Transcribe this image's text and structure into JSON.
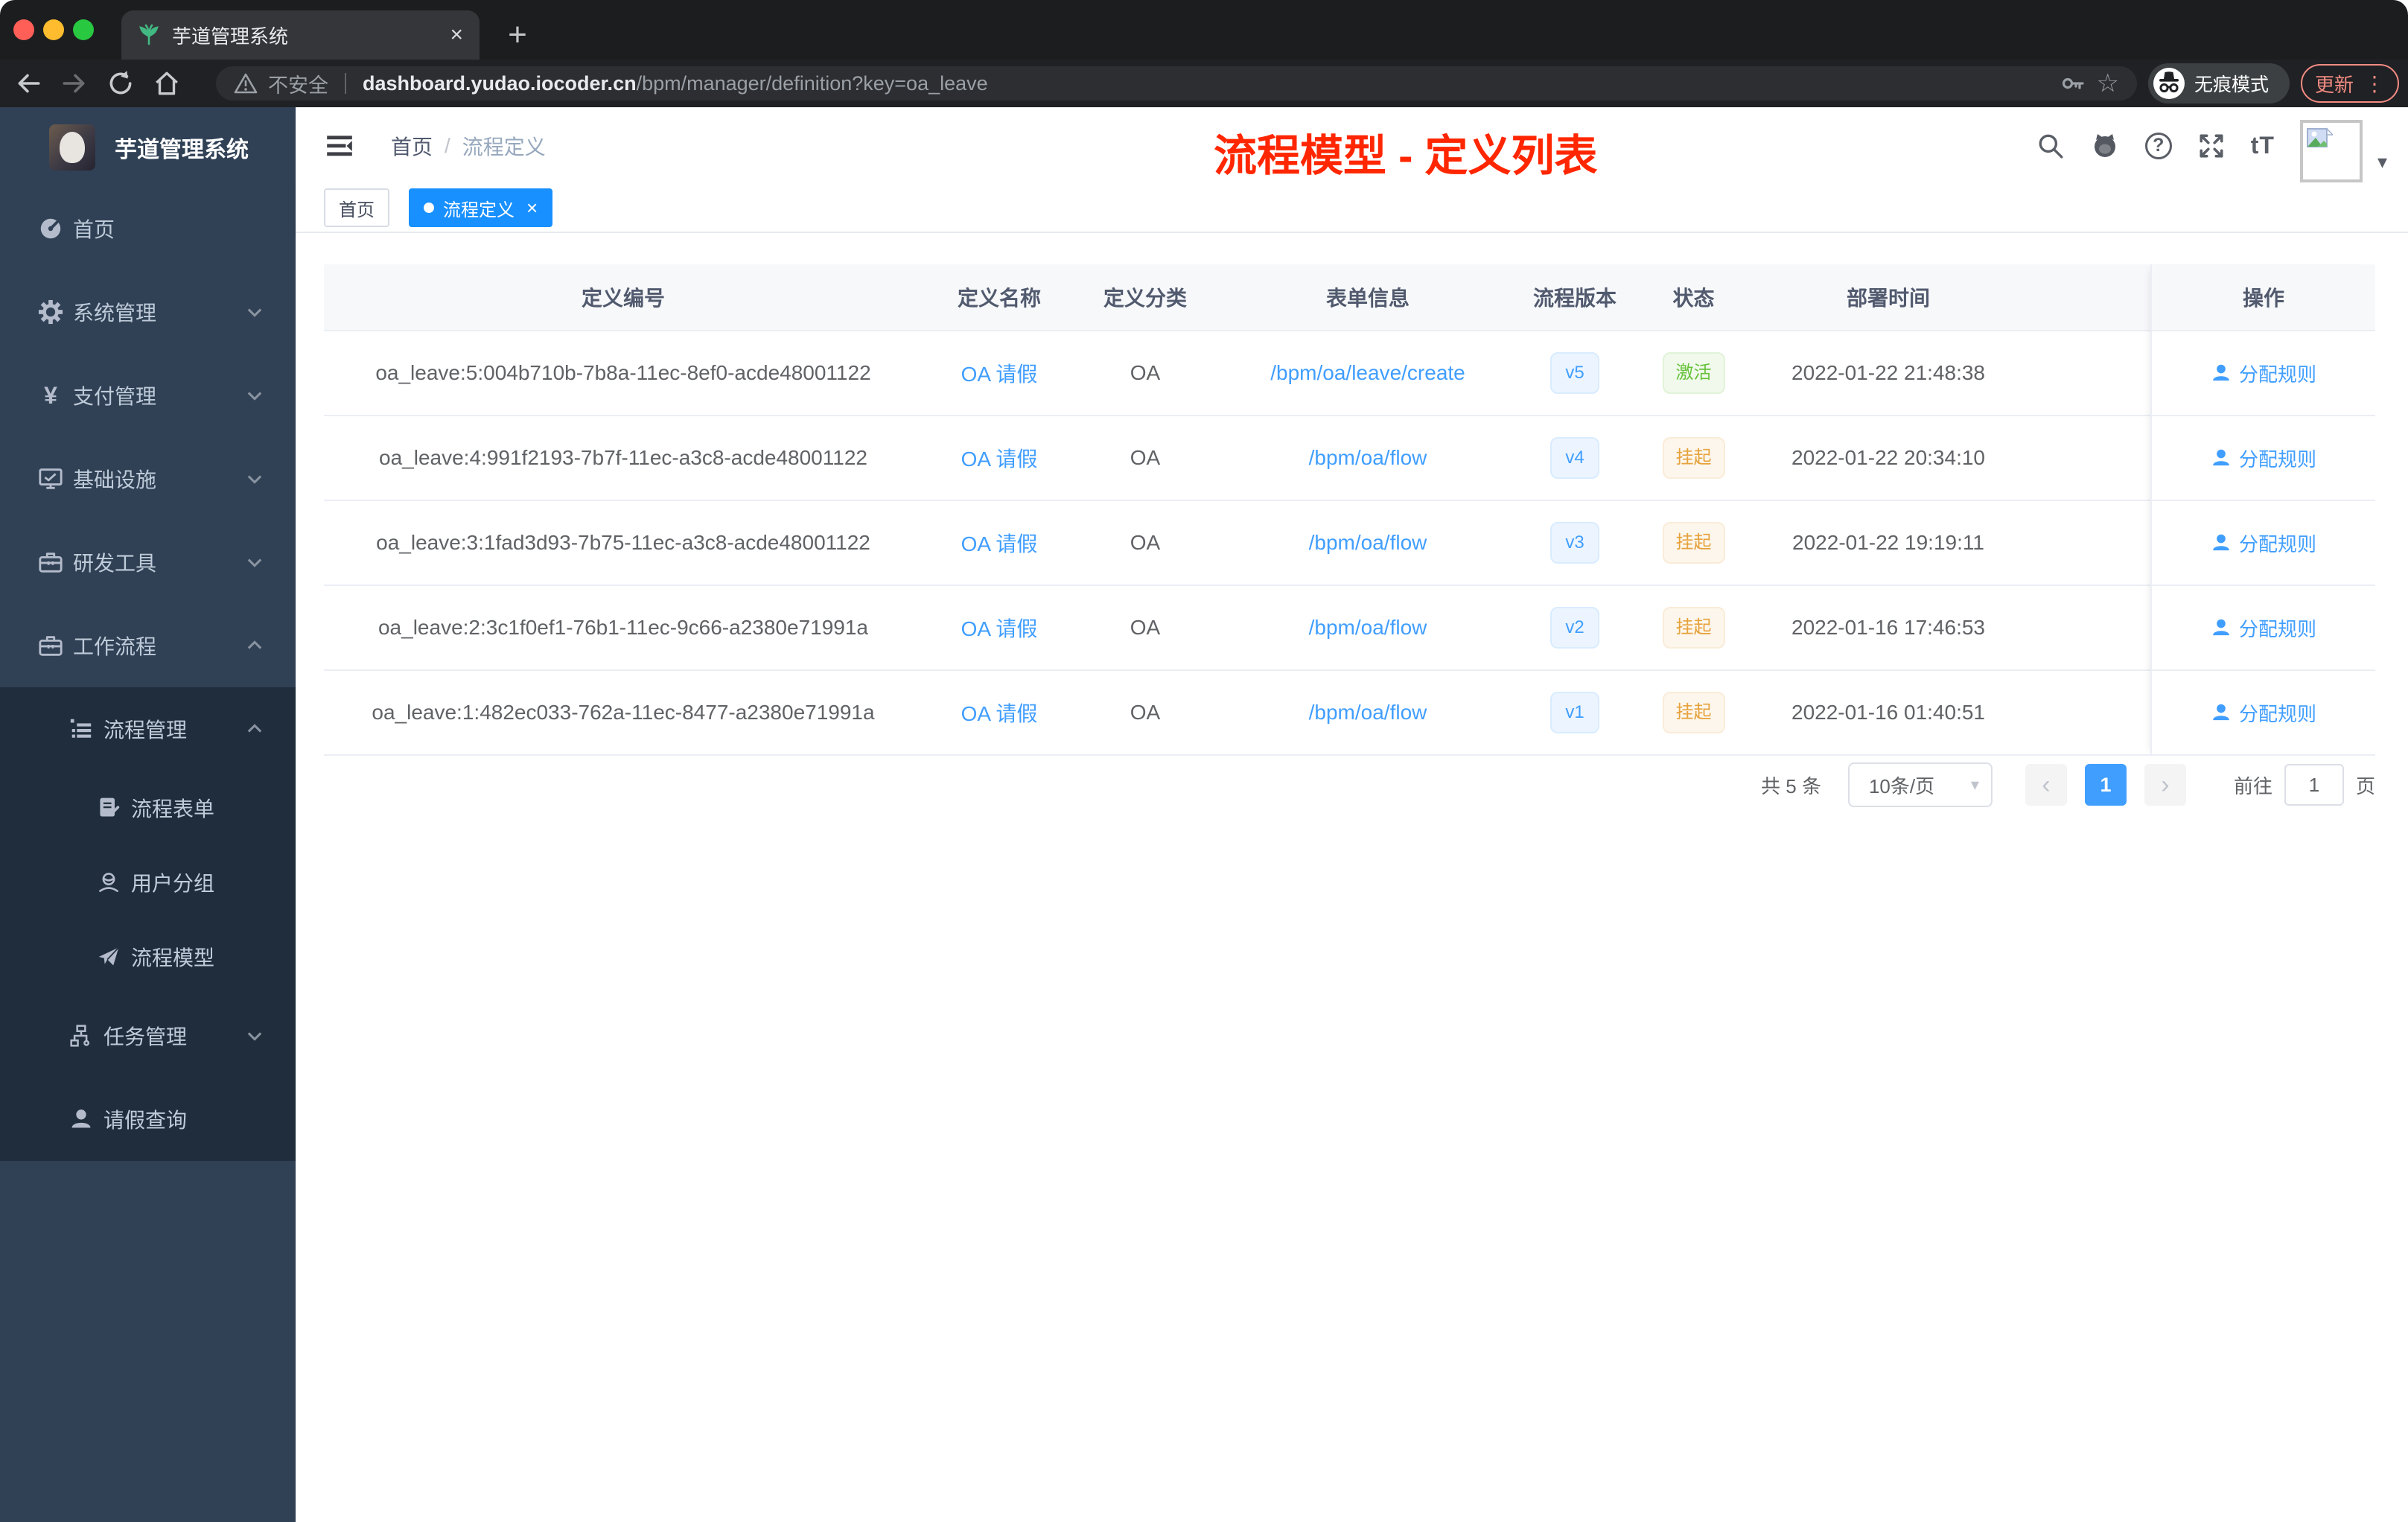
{
  "glyphs": {
    "close_tab": "×",
    "new_tab": "+",
    "kebab": "⋮",
    "star": "☆",
    "question": "?",
    "text_size": "tT",
    "caret_down": "▾",
    "slash": "/",
    "tag_close": "×",
    "prev": "‹",
    "next": "›"
  },
  "browser": {
    "tab_title": "芋道管理系统",
    "security_label": "不安全",
    "url_domain": "dashboard.yudao.iocoder.cn",
    "url_path": "/bpm/manager/definition?key=oa_leave",
    "incognito_label": "无痕模式",
    "update_label": "更新"
  },
  "sidebar": {
    "app_title": "芋道管理系统",
    "items": [
      {
        "label": "首页"
      },
      {
        "label": "系统管理"
      },
      {
        "label": "支付管理"
      },
      {
        "label": "基础设施"
      },
      {
        "label": "研发工具"
      },
      {
        "label": "工作流程"
      },
      {
        "label": "流程管理"
      },
      {
        "label": "流程表单"
      },
      {
        "label": "用户分组"
      },
      {
        "label": "流程模型"
      },
      {
        "label": "任务管理"
      },
      {
        "label": "请假查询"
      }
    ]
  },
  "navbar": {
    "breadcrumb_home": "首页",
    "breadcrumb_current": "流程定义"
  },
  "annotation": {
    "title": "流程模型 - 定义列表",
    "color": "#ff2600"
  },
  "tags": {
    "home": "首页",
    "active": "流程定义"
  },
  "table": {
    "columns": [
      "定义编号",
      "定义名称",
      "定义分类",
      "表单信息",
      "流程版本",
      "状态",
      "部署时间",
      "操作"
    ],
    "rows": [
      {
        "id": "oa_leave:5:004b710b-7b8a-11ec-8ef0-acde48001122",
        "name": "OA 请假",
        "category": "OA",
        "form": "/bpm/oa/leave/create",
        "version": "v5",
        "status": "激活",
        "deploy_time": "2022-01-22 21:48:38",
        "action": "分配规则"
      },
      {
        "id": "oa_leave:4:991f2193-7b7f-11ec-a3c8-acde48001122",
        "name": "OA 请假",
        "category": "OA",
        "form": "/bpm/oa/flow",
        "version": "v4",
        "status": "挂起",
        "deploy_time": "2022-01-22 20:34:10",
        "action": "分配规则"
      },
      {
        "id": "oa_leave:3:1fad3d93-7b75-11ec-a3c8-acde48001122",
        "name": "OA 请假",
        "category": "OA",
        "form": "/bpm/oa/flow",
        "version": "v3",
        "status": "挂起",
        "deploy_time": "2022-01-22 19:19:11",
        "action": "分配规则"
      },
      {
        "id": "oa_leave:2:3c1f0ef1-76b1-11ec-9c66-a2380e71991a",
        "name": "OA 请假",
        "category": "OA",
        "form": "/bpm/oa/flow",
        "version": "v2",
        "status": "挂起",
        "deploy_time": "2022-01-16 17:46:53",
        "action": "分配规则"
      },
      {
        "id": "oa_leave:1:482ec033-762a-11ec-8477-a2380e71991a",
        "name": "OA 请假",
        "category": "OA",
        "form": "/bpm/oa/flow",
        "version": "v1",
        "status": "挂起",
        "deploy_time": "2022-01-16 01:40:51",
        "action": "分配规则"
      }
    ]
  },
  "pagination": {
    "total": "共 5 条",
    "page_size": "10条/页",
    "current_page": "1",
    "goto_label": "前往",
    "goto_value": "1",
    "page_unit": "页"
  },
  "colors": {
    "accent": "#409eff",
    "tag_active": "#1890ff",
    "success": "#67c23a",
    "warning": "#e6a23c",
    "annotation_red": "#ff2600",
    "update_coral": "#f28b82",
    "sidebar_bg": "#304156",
    "submenu_bg": "#1f2d3d"
  }
}
